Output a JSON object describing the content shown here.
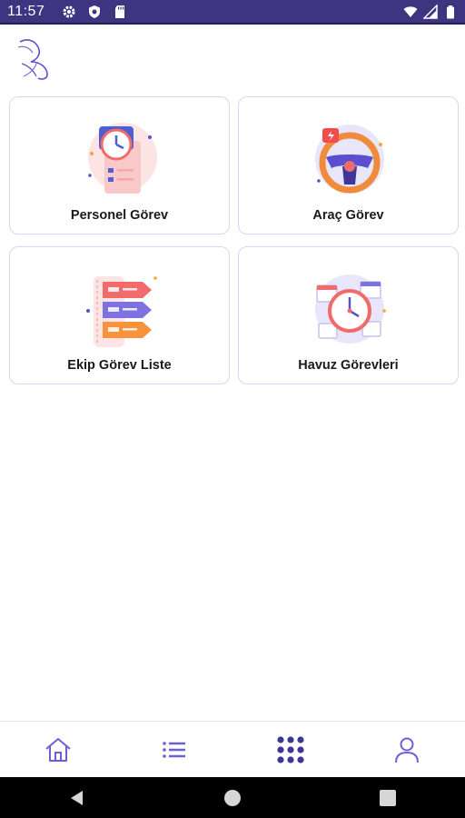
{
  "status_bar": {
    "time": "11:57",
    "left_icons": [
      "gear-icon",
      "shield-icon",
      "sd-card-icon"
    ],
    "right_icons": [
      "wifi-icon",
      "cell-signal-icon",
      "battery-icon"
    ]
  },
  "app": {
    "logo": "bird-logo-icon"
  },
  "cards": [
    {
      "label": "Personel Görev",
      "icon": "task-list-clock-illustration"
    },
    {
      "label": "Araç Görev",
      "icon": "steering-wheel-illustration"
    },
    {
      "label": "Ekip Görev Liste",
      "icon": "arrow-list-illustration"
    },
    {
      "label": "Havuz Görevleri",
      "icon": "clock-calendar-illustration"
    }
  ],
  "bottom_nav": [
    {
      "icon": "home-icon",
      "active": false
    },
    {
      "icon": "list-icon",
      "active": false
    },
    {
      "icon": "grid-icon",
      "active": true
    },
    {
      "icon": "user-icon",
      "active": false
    }
  ],
  "system_nav": [
    "back-icon",
    "home-circle-icon",
    "recents-icon"
  ],
  "colors": {
    "accent": "#5b4fcf",
    "status_bar": "#3d3580",
    "card_border": "#d9d6f3"
  }
}
